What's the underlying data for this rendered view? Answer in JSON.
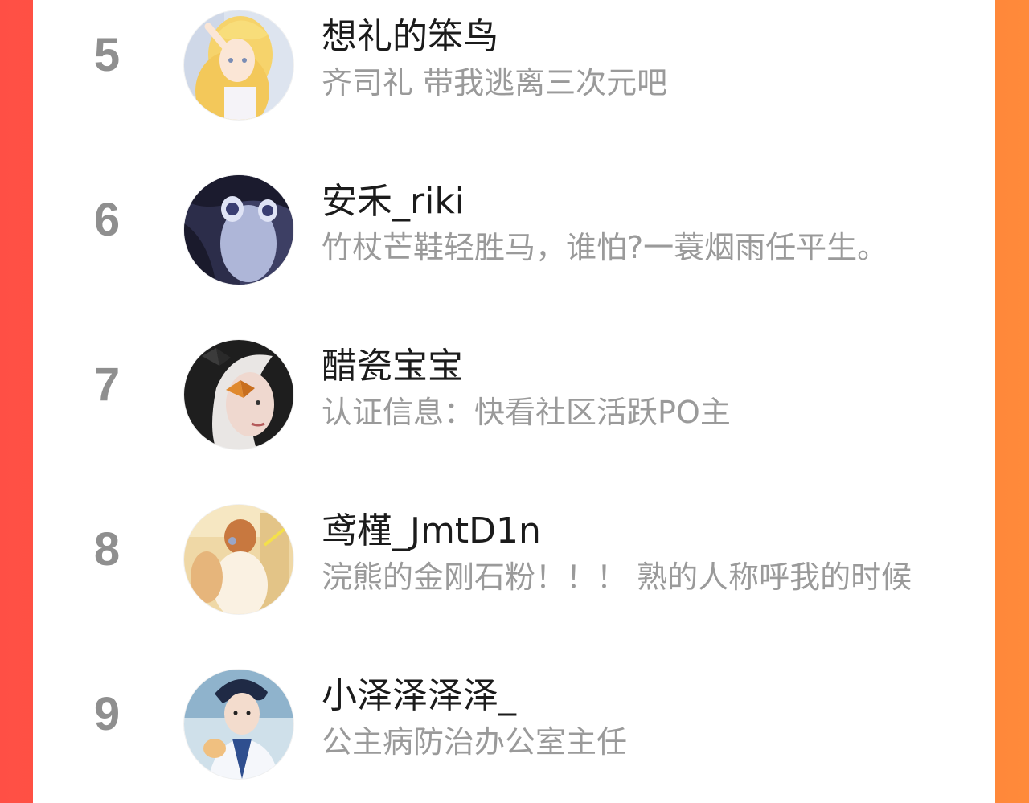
{
  "ranking": {
    "rows": [
      {
        "rank": "5",
        "name": "想礼的笨鸟",
        "bio": "齐司礼 带我逃离三次元吧",
        "avatar_icon": "avatar-anime-blonde-girl"
      },
      {
        "rank": "6",
        "name": "安禾_riki",
        "bio": "竹杖芒鞋轻胜马，谁怕?一蓑烟雨任平生。",
        "avatar_icon": "avatar-anime-dark-girl"
      },
      {
        "rank": "7",
        "name": "醋瓷宝宝",
        "bio": "认证信息：快看社区活跃PO主",
        "avatar_icon": "avatar-butterfly-girl"
      },
      {
        "rank": "8",
        "name": "鸢槿_JmtD1n",
        "bio": "浣熊的金刚石粉！！！ 熟的人称呼我的时候",
        "avatar_icon": "avatar-golden-illustration"
      },
      {
        "rank": "9",
        "name": "小泽泽泽泽_",
        "bio": "公主病防治办公室主任",
        "avatar_icon": "avatar-anime-boy"
      }
    ]
  },
  "colors": {
    "background_left": "#ff4f45",
    "background_right": "#ff8a3a",
    "rank_text": "#8f8f8f",
    "name_text": "#1b1b1b",
    "bio_text": "#9a9a9a"
  }
}
